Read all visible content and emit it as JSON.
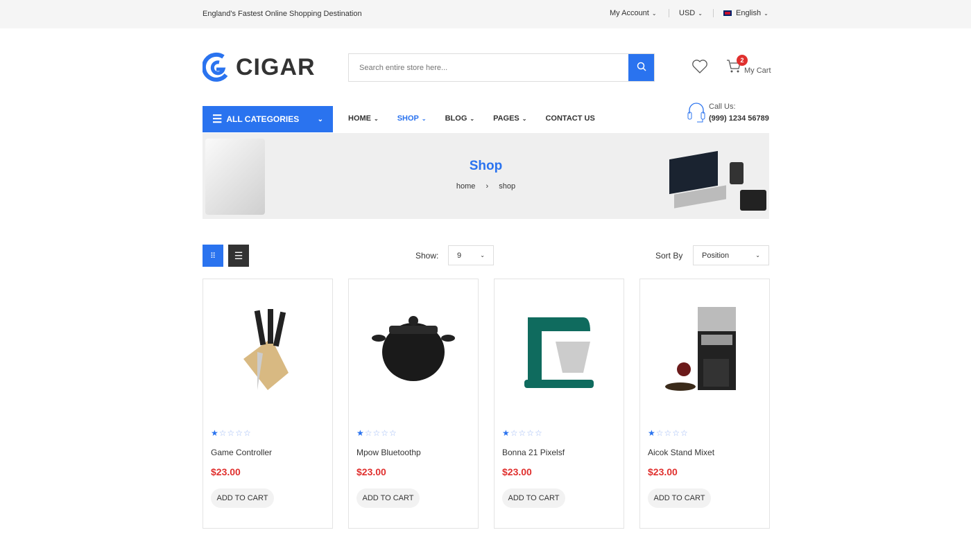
{
  "topbar": {
    "tagline": "England's Fastest Online Shopping Destination",
    "account": "My Account",
    "currency": "USD",
    "language": "English"
  },
  "header": {
    "logo": "CIGAR",
    "search_placeholder": "Search entire store here...",
    "cart_count": "2",
    "cart_label": "My Cart"
  },
  "nav": {
    "categories": "ALL CATEGORIES",
    "items": [
      "HOME",
      "SHOP",
      "BLOG",
      "PAGES",
      "CONTACT US"
    ],
    "active": "SHOP",
    "call_label": "Call Us:",
    "phone": "(999) 1234 56789"
  },
  "banner": {
    "title": "Shop",
    "breadcrumb": [
      "home",
      "shop"
    ]
  },
  "toolbar": {
    "show_label": "Show:",
    "show_value": "9",
    "sort_label": "Sort By",
    "sort_value": "Position"
  },
  "products": [
    {
      "name": "Game Controller",
      "price": "$23.00",
      "rating": 1,
      "button": "ADD TO CART",
      "icon": "knife-block"
    },
    {
      "name": "Mpow Bluetoothp",
      "price": "$23.00",
      "rating": 1,
      "button": "ADD TO CART",
      "icon": "pot"
    },
    {
      "name": "Bonna 21 Pixelsf",
      "price": "$23.00",
      "rating": 1,
      "button": "ADD TO CART",
      "icon": "stand-mixer"
    },
    {
      "name": "Aicok Stand Mixet",
      "price": "$23.00",
      "rating": 1,
      "button": "ADD TO CART",
      "icon": "coffee-maker"
    }
  ],
  "colors": {
    "accent": "#2a73ef",
    "price": "#e0302e"
  }
}
